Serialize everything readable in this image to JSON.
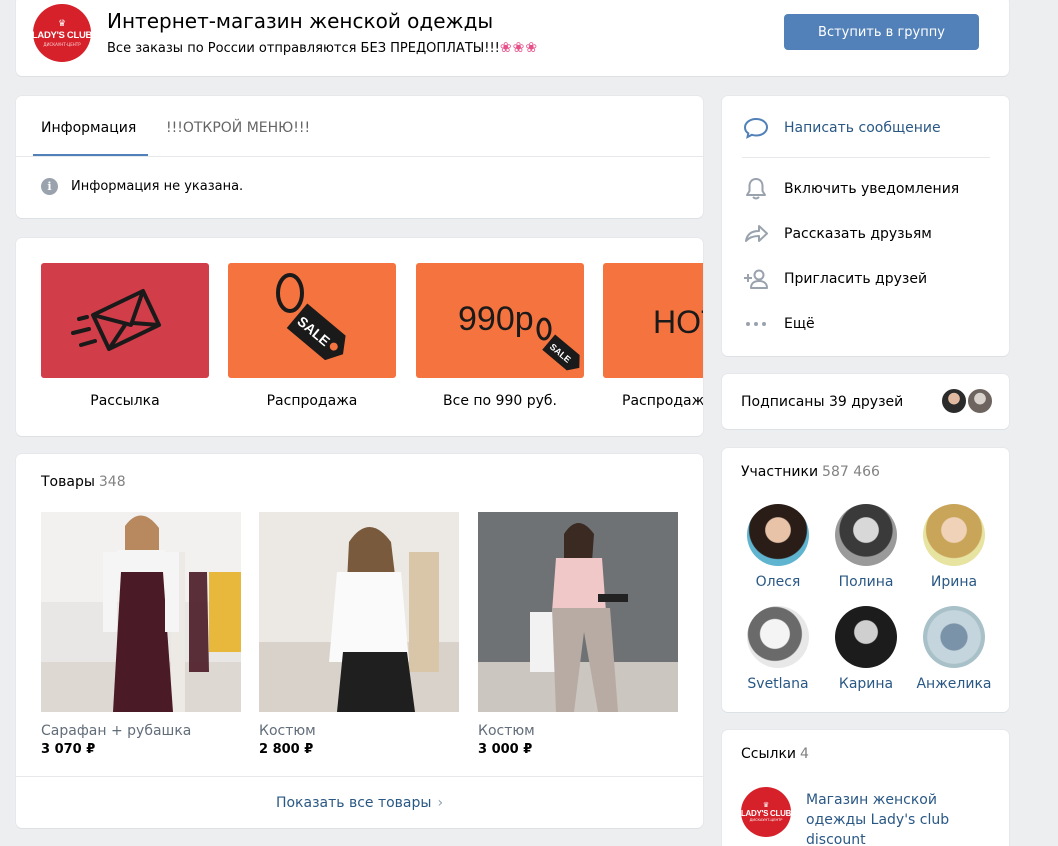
{
  "header": {
    "logo_text": "LADY'S CLUB",
    "logo_sub": "ДИСКАУНТ-ЦЕНТР",
    "title": "Интернет-магазин женской одежды",
    "status": "Все заказы по России отправляются БЕЗ ПРЕДОПЛАТЫ!!!",
    "status_emoji": "❀❀❀",
    "join_button": "Вступить в группу"
  },
  "info": {
    "tabs": [
      {
        "label": "Информация",
        "active": true
      },
      {
        "label": "!!!ОТКРОЙ МЕНЮ!!!",
        "active": false
      }
    ],
    "icon": "info-icon",
    "text": "Информация не указана."
  },
  "menu": {
    "tiles": [
      {
        "label": "Рассылка",
        "image_text": "",
        "icon": "envelope-icon",
        "color": "#d13d48"
      },
      {
        "label": "Распродажа",
        "image_text": "SALE",
        "icon": "sale-tag-icon",
        "color": "#f5733f"
      },
      {
        "label": "Все по 990 руб.",
        "image_text": "990р",
        "tag_text": "SALE",
        "icon": "sale-tag-icon",
        "color": "#f5733f"
      },
      {
        "label": "Распродаж",
        "image_text": "HOT",
        "icon": "",
        "color": "#f5733f"
      }
    ]
  },
  "goods": {
    "title": "Товары",
    "count": "348",
    "items": [
      {
        "name": "Сарафан + рубашка",
        "price": "3 070 ₽"
      },
      {
        "name": "Костюм",
        "price": "2 800 ₽"
      },
      {
        "name": "Костюм",
        "price": "3 000 ₽"
      }
    ],
    "show_all": "Показать все товары"
  },
  "actions": {
    "items": [
      {
        "label": "Написать сообщение",
        "icon": "message-icon"
      },
      {
        "label": "Включить уведомления",
        "icon": "bell-icon"
      },
      {
        "label": "Рассказать друзьям",
        "icon": "share-icon"
      },
      {
        "label": "Пригласить друзей",
        "icon": "add-friend-icon"
      },
      {
        "label": "Ещё",
        "icon": "more-icon"
      }
    ]
  },
  "friends": {
    "text": "Подписаны 39 друзей"
  },
  "members": {
    "title": "Участники",
    "count": "587 466",
    "people": [
      {
        "name": "Олеся"
      },
      {
        "name": "Полина"
      },
      {
        "name": "Ирина"
      },
      {
        "name": "Svetlana"
      },
      {
        "name": "Карина"
      },
      {
        "name": "Анжелика"
      }
    ]
  },
  "links": {
    "title": "Ссылки",
    "count": "4",
    "items": [
      {
        "text": "Магазин женской одежды Lady's club discount"
      }
    ]
  },
  "colors": {
    "accent": "#5181b8",
    "link": "#2a5885",
    "brand_red": "#d6212a",
    "tile_orange": "#f5733f",
    "tile_red": "#d13d48"
  }
}
